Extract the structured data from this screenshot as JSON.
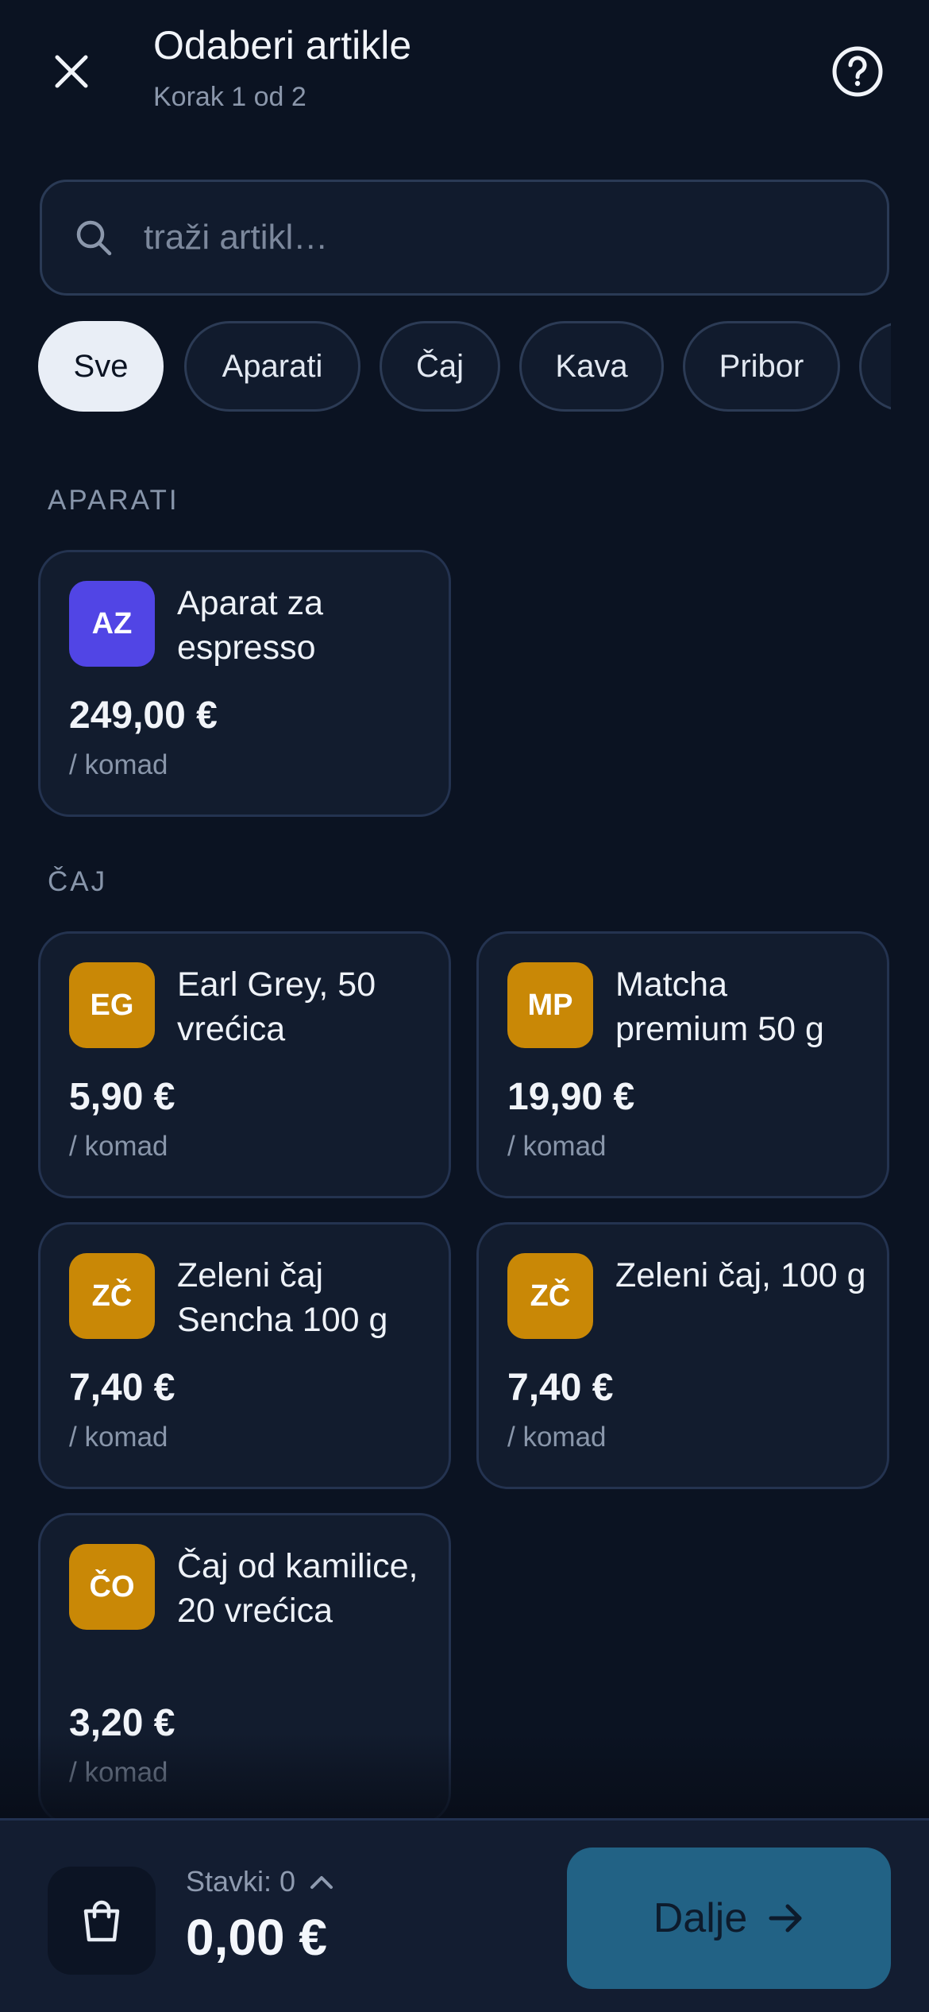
{
  "header": {
    "title": "Odaberi artikle",
    "subtitle": "Korak 1 od 2",
    "close_icon": "close-icon",
    "help_icon": "help-circle-icon"
  },
  "search": {
    "placeholder": "traži artikl…",
    "value": ""
  },
  "filters": [
    {
      "label": "Sve",
      "active": true
    },
    {
      "label": "Aparati",
      "active": false
    },
    {
      "label": "Čaj",
      "active": false
    },
    {
      "label": "Kava",
      "active": false
    },
    {
      "label": "Pribor",
      "active": false
    }
  ],
  "sections": [
    {
      "label": "APARATI",
      "items": [
        {
          "initials": "AZ",
          "name": "Aparat za espresso",
          "price": "249,00 €",
          "unit": "/ komad",
          "color": "#5145e5"
        }
      ]
    },
    {
      "label": "ČAJ",
      "items": [
        {
          "initials": "EG",
          "name": "Earl Grey, 50 vrećica",
          "price": "5,90 €",
          "unit": "/ komad",
          "color": "#c98806"
        },
        {
          "initials": "MP",
          "name": "Matcha premium 50 g",
          "price": "19,90 €",
          "unit": "/ komad",
          "color": "#c98806"
        },
        {
          "initials": "ZČ",
          "name": "Zeleni čaj Sencha 100 g",
          "price": "7,40 €",
          "unit": "/ komad",
          "color": "#c98806"
        },
        {
          "initials": "ZČ",
          "name": "Zeleni čaj, 100 g",
          "price": "7,40 €",
          "unit": "/ komad",
          "color": "#c98806"
        },
        {
          "initials": "ČO",
          "name": "Čaj od kamilice, 20 vrećica",
          "price": "3,20 €",
          "unit": "/ komad",
          "color": "#c98806"
        }
      ]
    }
  ],
  "footer": {
    "items_label": "Stavki: 0",
    "total": "0,00 €",
    "next_label": "Dalje",
    "cart_icon": "shopping-bag-icon",
    "expand_icon": "chevron-up-icon",
    "next_icon": "arrow-right-icon"
  },
  "colors": {
    "background": "#0b1322",
    "card": "#121c2e",
    "accent_button": "#226285",
    "tea_avatar": "#c98806",
    "appliance_avatar": "#5145e5"
  }
}
